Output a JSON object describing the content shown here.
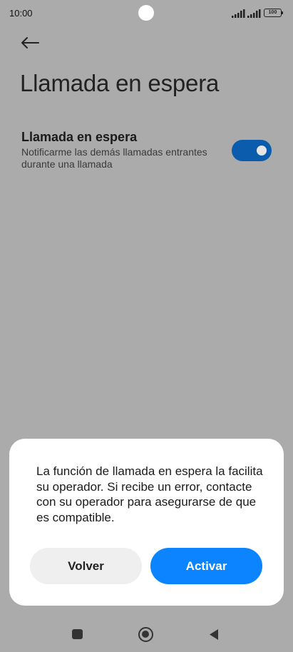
{
  "status_bar": {
    "time": "10:00",
    "battery": "100"
  },
  "header": {
    "back_icon": "arrow-left-icon",
    "title": "Llamada en espera"
  },
  "setting": {
    "title": "Llamada en espera",
    "description": "Notificarme las demás llamadas entrantes durante una llamada",
    "toggle_on": true,
    "toggle_color": "#0c5cad"
  },
  "dialog": {
    "message": "La función de llamada en espera la facilita su operador. Si recibe un error, contacte con su operador para asegurarse de que es compatible.",
    "back_label": "Volver",
    "activate_label": "Activar",
    "activate_color": "#0d84ff"
  },
  "nav_bar": {
    "icons": [
      "recents-square-icon",
      "home-circle-icon",
      "back-triangle-icon"
    ]
  },
  "colors": {
    "background_dimmed": "#ababab",
    "dialog_bg": "#ffffff"
  }
}
